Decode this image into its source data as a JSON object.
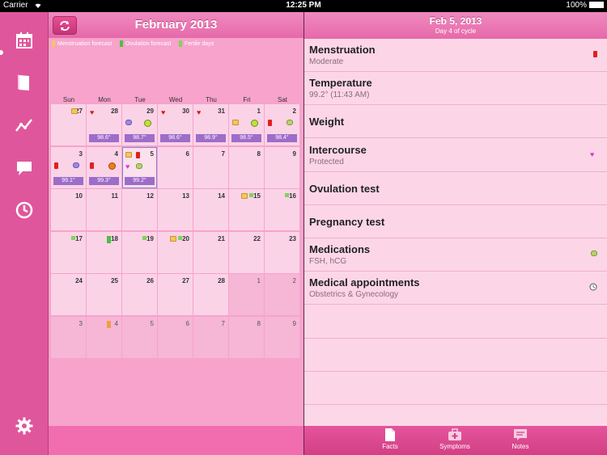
{
  "status": {
    "carrier": "Carrier",
    "time": "12:25 PM",
    "battery": "100%"
  },
  "sidebar": {
    "items": [
      "calendar-icon",
      "book-icon",
      "chart-icon",
      "notes-bubble-icon",
      "clock-icon",
      "gear-icon"
    ]
  },
  "calendar": {
    "title": "February 2013",
    "legend": [
      {
        "label": "Menstruation forecast",
        "color": "#f2c75c"
      },
      {
        "label": "Ovulation forecast",
        "color": "#4cc23e"
      },
      {
        "label": "Fertile days",
        "color": "#7fd35f"
      }
    ],
    "weekdays": [
      "Sun",
      "Mon",
      "Tue",
      "Wed",
      "Thu",
      "Fri",
      "Sat"
    ],
    "weeks": [
      [
        {
          "n": "27",
          "dim": false,
          "icons": [
            "pad"
          ]
        },
        {
          "n": "28",
          "dim": false,
          "icons": [
            "heart"
          ],
          "temp": "98.6°"
        },
        {
          "n": "29",
          "dim": false,
          "icons": [
            "pill",
            "smile"
          ],
          "temp": "98.7°"
        },
        {
          "n": "30",
          "dim": false,
          "icons": [
            "heart"
          ],
          "temp": "98.6°"
        },
        {
          "n": "31",
          "dim": false,
          "icons": [
            "heart"
          ],
          "temp": "98.9°"
        },
        {
          "n": "1",
          "dim": false,
          "icons": [
            "pad",
            "smile"
          ],
          "temp": "98.5°"
        },
        {
          "n": "2",
          "dim": false,
          "icons": [
            "drop",
            "pillg"
          ],
          "temp": "98.4°"
        }
      ],
      [
        {
          "n": "3",
          "dim": false,
          "icons": [
            "drop",
            "pill"
          ],
          "temp": "99.1°"
        },
        {
          "n": "4",
          "dim": false,
          "icons": [
            "drop",
            "smileo"
          ],
          "temp": "99.3°"
        },
        {
          "n": "5",
          "dim": false,
          "sel": true,
          "icons": [
            "pad",
            "drop",
            "heartpk",
            "pillg"
          ],
          "temp": "99.2°"
        },
        {
          "n": "6",
          "dim": false,
          "icons": []
        },
        {
          "n": "7",
          "dim": false,
          "icons": []
        },
        {
          "n": "8",
          "dim": false,
          "icons": []
        },
        {
          "n": "9",
          "dim": false,
          "icons": []
        }
      ],
      [
        {
          "n": "10",
          "dim": false,
          "icons": []
        },
        {
          "n": "11",
          "dim": false,
          "icons": []
        },
        {
          "n": "12",
          "dim": false,
          "icons": []
        },
        {
          "n": "13",
          "dim": false,
          "icons": []
        },
        {
          "n": "14",
          "dim": false,
          "icons": []
        },
        {
          "n": "15",
          "dim": false,
          "icons": [
            "pad",
            "fsq"
          ]
        },
        {
          "n": "16",
          "dim": false,
          "icons": [
            "fsq"
          ]
        }
      ],
      [
        {
          "n": "17",
          "dim": false,
          "icons": [
            "fsq"
          ]
        },
        {
          "n": "18",
          "dim": false,
          "icons": [
            "gsq"
          ]
        },
        {
          "n": "19",
          "dim": false,
          "icons": [
            "fsq"
          ]
        },
        {
          "n": "20",
          "dim": false,
          "icons": [
            "pad",
            "fsq"
          ]
        },
        {
          "n": "21",
          "dim": false,
          "icons": []
        },
        {
          "n": "22",
          "dim": false,
          "icons": []
        },
        {
          "n": "23",
          "dim": false,
          "icons": []
        }
      ],
      [
        {
          "n": "24",
          "dim": false,
          "icons": []
        },
        {
          "n": "25",
          "dim": false,
          "icons": []
        },
        {
          "n": "26",
          "dim": false,
          "icons": []
        },
        {
          "n": "27",
          "dim": false,
          "icons": []
        },
        {
          "n": "28",
          "dim": false,
          "icons": []
        },
        {
          "n": "1",
          "dim": true,
          "icons": []
        },
        {
          "n": "2",
          "dim": true,
          "icons": []
        }
      ],
      [
        {
          "n": "3",
          "dim": true,
          "icons": []
        },
        {
          "n": "4",
          "dim": true,
          "icons": [
            "osq"
          ]
        },
        {
          "n": "5",
          "dim": true,
          "icons": []
        },
        {
          "n": "6",
          "dim": true,
          "icons": []
        },
        {
          "n": "7",
          "dim": true,
          "icons": []
        },
        {
          "n": "8",
          "dim": true,
          "icons": []
        },
        {
          "n": "9",
          "dim": true,
          "icons": []
        }
      ]
    ]
  },
  "detail": {
    "date": "Feb 5, 2013",
    "subtitle": "Day 4 of cycle",
    "rows": [
      {
        "title": "Menstruation",
        "sub": "Moderate",
        "icon": "drop"
      },
      {
        "title": "Temperature",
        "sub": "99.2° (11:43 AM)",
        "icon": ""
      },
      {
        "title": "Weight",
        "sub": "",
        "icon": ""
      },
      {
        "title": "Intercourse",
        "sub": "Protected",
        "icon": "heartpk"
      },
      {
        "title": "Ovulation test",
        "sub": "",
        "icon": ""
      },
      {
        "title": "Pregnancy test",
        "sub": "",
        "icon": ""
      },
      {
        "title": "Medications",
        "sub": "FSH, hCG",
        "icon": "pillg"
      },
      {
        "title": "Medical appointments",
        "sub": "Obstetrics & Gynecology",
        "icon": "clock"
      },
      {
        "title": "",
        "sub": "",
        "icon": ""
      },
      {
        "title": "",
        "sub": "",
        "icon": ""
      },
      {
        "title": "",
        "sub": "",
        "icon": ""
      }
    ]
  },
  "tabs": [
    {
      "label": "Facts",
      "icon": "document-icon"
    },
    {
      "label": "Symptoms",
      "icon": "medkit-icon"
    },
    {
      "label": "Notes",
      "icon": "notes-icon"
    }
  ]
}
